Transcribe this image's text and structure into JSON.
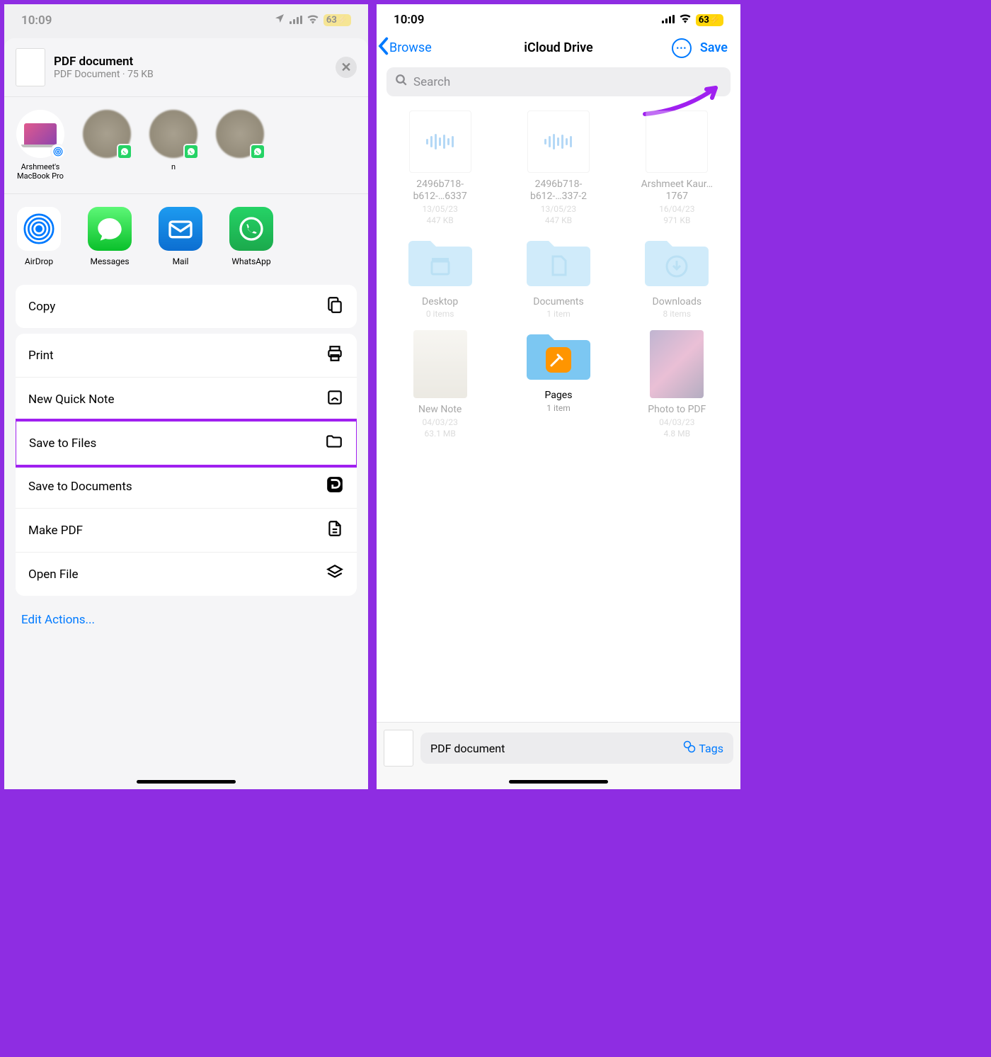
{
  "left": {
    "status_time": "10:09",
    "battery": "63",
    "file_name": "PDF document",
    "file_meta": "PDF Document · 75 KB",
    "contacts": [
      {
        "label": "Arshmeet's MacBook Pro"
      },
      {
        "label": ""
      },
      {
        "label": "n"
      },
      {
        "label": ""
      }
    ],
    "apps": [
      {
        "label": "AirDrop"
      },
      {
        "label": "Messages"
      },
      {
        "label": "Mail"
      },
      {
        "label": "WhatsApp"
      }
    ],
    "actions": {
      "copy": "Copy",
      "print": "Print",
      "note": "New Quick Note",
      "save_files": "Save to Files",
      "save_docs": "Save to Documents",
      "make_pdf": "Make PDF",
      "open_file": "Open File"
    },
    "edit_actions": "Edit Actions..."
  },
  "right": {
    "status_time": "10:09",
    "battery": "63",
    "back": "Browse",
    "title": "iCloud Drive",
    "save": "Save",
    "search_placeholder": "Search",
    "grid": [
      {
        "name": "2496b718-b612-…6337",
        "date": "13/05/23",
        "size": "447 KB",
        "type": "audio"
      },
      {
        "name": "2496b718-b612-…337-2",
        "date": "13/05/23",
        "size": "447 KB",
        "type": "audio"
      },
      {
        "name": "Arshmeet Kaur…1767",
        "date": "16/04/23",
        "size": "971 KB",
        "type": "doc"
      },
      {
        "name": "Desktop",
        "date": "0 items",
        "size": "",
        "type": "folder-desktop"
      },
      {
        "name": "Documents",
        "date": "1 item",
        "size": "",
        "type": "folder-docs"
      },
      {
        "name": "Downloads",
        "date": "8 items",
        "size": "",
        "type": "folder-downloads"
      },
      {
        "name": "New Note",
        "date": "04/03/23",
        "size": "63.1 MB",
        "type": "img1"
      },
      {
        "name": "Pages",
        "date": "1 item",
        "size": "",
        "type": "folder-pages",
        "active": true
      },
      {
        "name": "Photo to PDF",
        "date": "04/03/23",
        "size": "4.8 MB",
        "type": "img2"
      }
    ],
    "bottom_name": "PDF document",
    "tags": "Tags"
  }
}
